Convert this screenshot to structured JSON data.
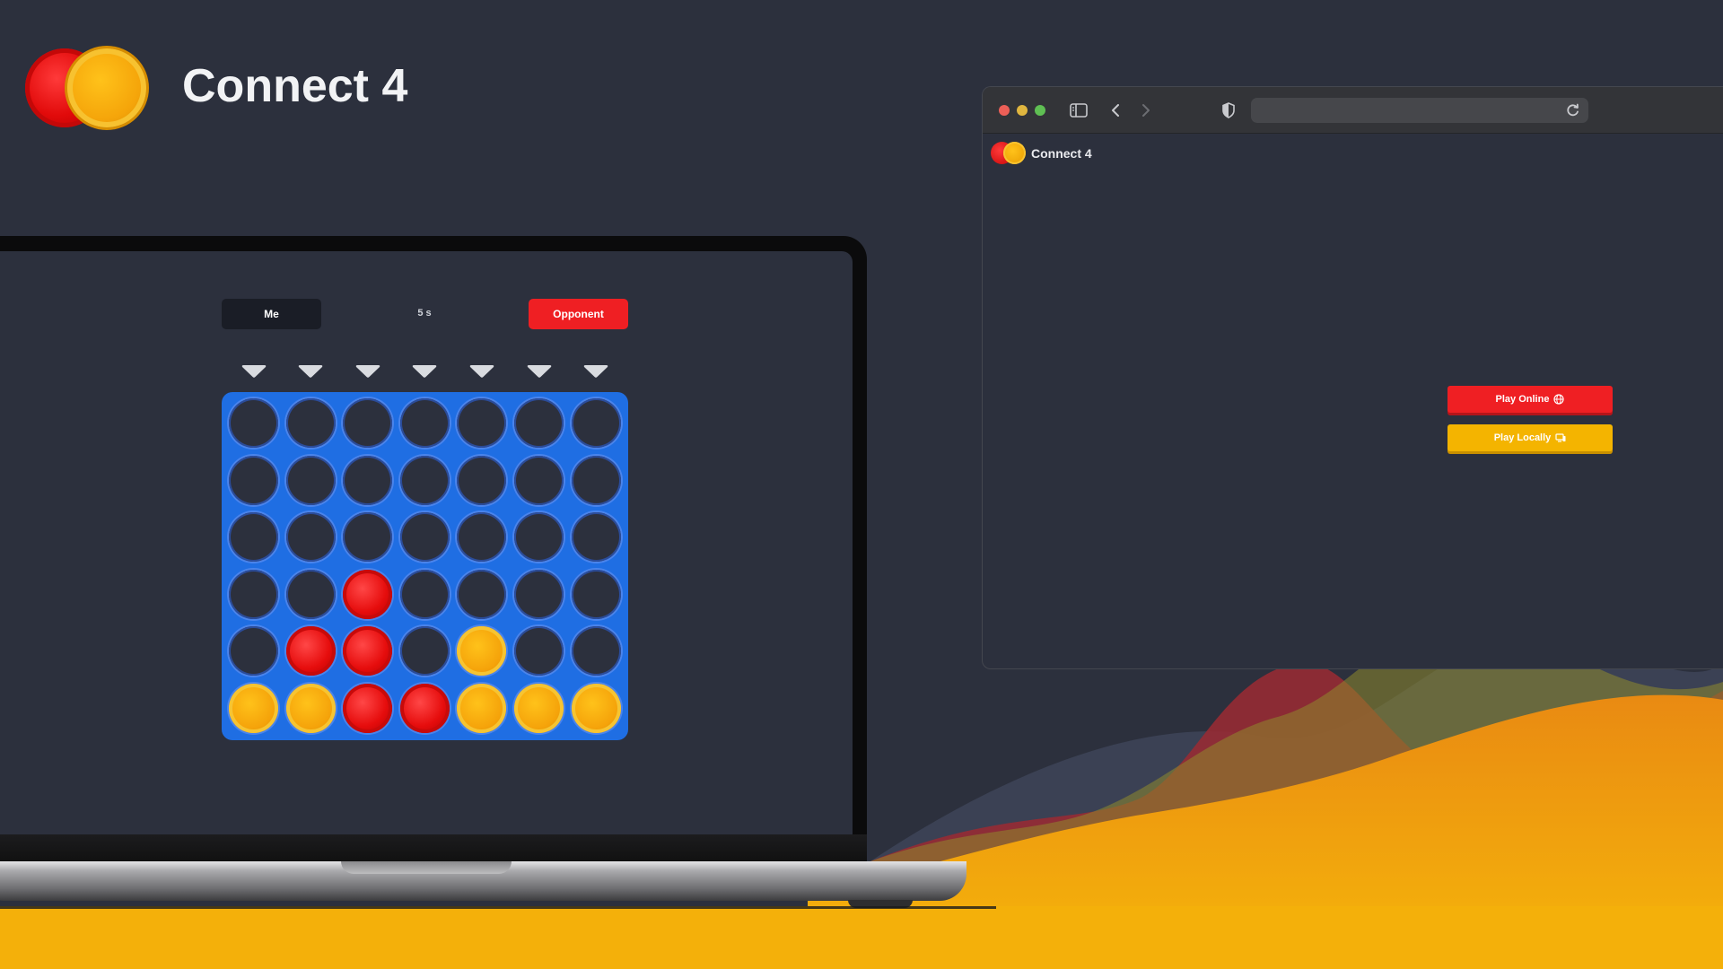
{
  "app": {
    "title": "Connect 4"
  },
  "game": {
    "player_me": "Me",
    "player_opponent": "Opponent",
    "timer": "5 s",
    "columns": 7,
    "rows": 6,
    "board": [
      [
        "empty",
        "empty",
        "empty",
        "empty",
        "empty",
        "empty",
        "empty"
      ],
      [
        "empty",
        "empty",
        "empty",
        "empty",
        "empty",
        "empty",
        "empty"
      ],
      [
        "empty",
        "empty",
        "empty",
        "empty",
        "empty",
        "empty",
        "empty"
      ],
      [
        "empty",
        "empty",
        "red",
        "empty",
        "empty",
        "empty",
        "empty"
      ],
      [
        "empty",
        "red",
        "red",
        "empty",
        "yellow",
        "empty",
        "empty"
      ],
      [
        "yellow",
        "yellow",
        "red",
        "red",
        "yellow",
        "yellow",
        "yellow"
      ]
    ]
  },
  "browser": {
    "page_title": "Connect 4",
    "url": "",
    "play_online_label": "Play Online",
    "play_locally_label": "Play Locally",
    "icons": [
      "sidebar-icon",
      "back-icon",
      "forward-icon",
      "shield-icon",
      "reload-icon",
      "globe-icon",
      "devices-icon"
    ]
  },
  "colors": {
    "background": "#2c303d",
    "board": "#1f6ee3",
    "red": "#e60d0d",
    "yellow": "#f5a30a",
    "play_online": "#ef1f23",
    "play_locally": "#f4b400"
  }
}
